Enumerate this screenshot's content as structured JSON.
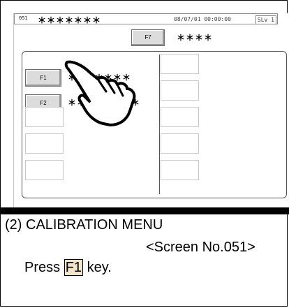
{
  "status_bar": {
    "screen_no": "051",
    "title": "＊＊＊＊＊＊＊",
    "datetime": "08/07/01 00:00:00",
    "security_level": "SLv 1"
  },
  "keys": {
    "f7": {
      "label": "F7",
      "text": "＊＊＊＊"
    },
    "f1": {
      "label": "F1",
      "text": "＊＊＊＊＊＊＊"
    },
    "f2": {
      "label": "F2",
      "text": "＊＊＊＊＊＊＊＊"
    }
  },
  "instructions": {
    "heading": "(2) CALIBRATION MENU",
    "screen_ref": "<Screen No.051>",
    "press": "Press",
    "key": "F1",
    "suffix": "key."
  },
  "colors": {
    "key_face": "#dcdcdc",
    "key_highlight": "#f2e6c8",
    "bottom_bar": "#000000"
  },
  "icons": {
    "pointer": "pointing-hand-icon"
  }
}
